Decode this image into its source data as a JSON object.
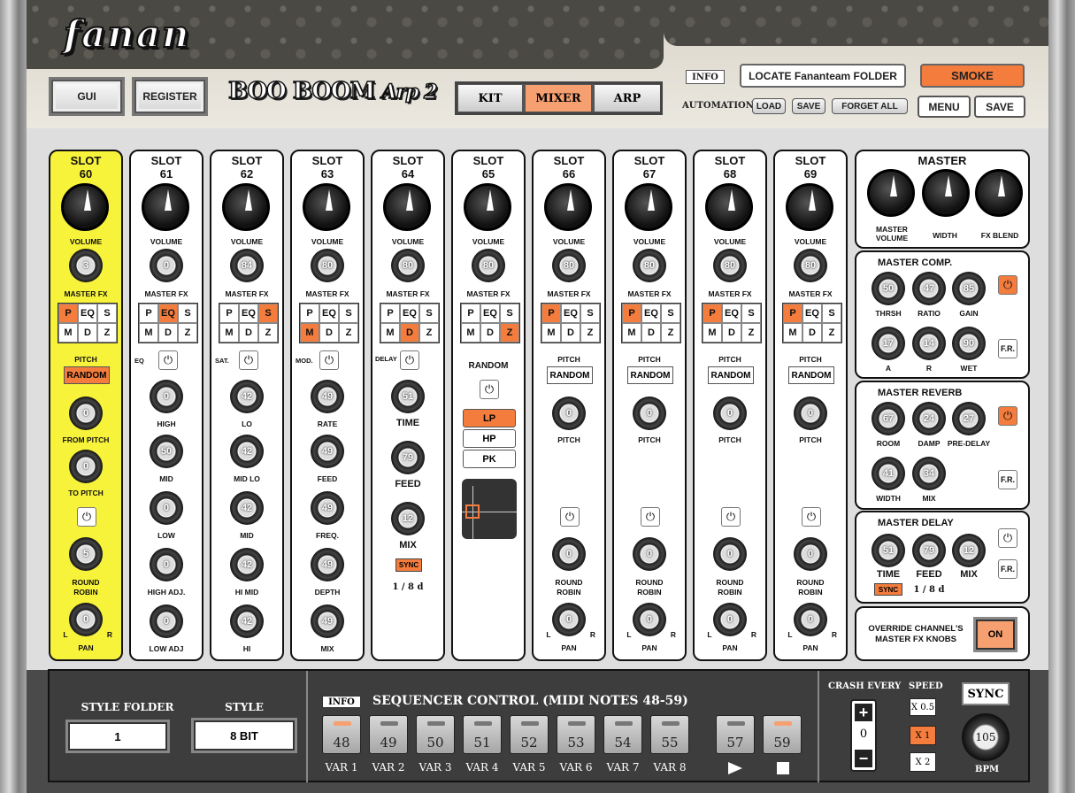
{
  "app": {
    "logo": "fanan",
    "title": "BOO BOOM",
    "title_suffix": "Arp 2"
  },
  "top": {
    "gui": "GUI",
    "register": "REGISTER",
    "tabs": [
      "KIT",
      "MIXER",
      "ARP"
    ],
    "active_tab": "MIXER",
    "info": "INFO",
    "locate": "LOCATE Fananteam FOLDER",
    "smoke": "SMOKE",
    "automation": "AUTOMATION",
    "load": "LOAD",
    "save_small": "SAVE",
    "forget_all": "FORGET ALL",
    "menu": "MENU",
    "save": "SAVE"
  },
  "labels": {
    "slot": "SLOT",
    "volume": "VOLUME",
    "master_fx": "MASTER FX",
    "pitch_head": "PITCH",
    "random": "RANDOM",
    "pitch": "PITCH",
    "from_pitch": "FROM PITCH",
    "to_pitch": "TO PITCH",
    "round": "ROUND",
    "robin": "ROBIN",
    "pan": "PAN",
    "l": "L",
    "r": "R",
    "p": "P",
    "eq": "EQ",
    "s": "S",
    "m": "M",
    "d": "D",
    "z": "Z"
  },
  "slots": [
    {
      "num": "60",
      "fx": "3"
    },
    {
      "num": "61",
      "fx": "0"
    },
    {
      "num": "62",
      "fx": "84"
    },
    {
      "num": "63",
      "fx": "80"
    },
    {
      "num": "64",
      "fx": "80"
    },
    {
      "num": "65",
      "fx": "80"
    },
    {
      "num": "66",
      "fx": "80"
    },
    {
      "num": "67",
      "fx": "80"
    },
    {
      "num": "68",
      "fx": "80"
    },
    {
      "num": "69",
      "fx": "80"
    }
  ],
  "slot60": {
    "from_pitch": "0",
    "to_pitch": "0",
    "round_robin": "5",
    "pan": "0"
  },
  "slot61": {
    "section": "EQ",
    "knobs": [
      {
        "v": "0",
        "l": "HIGH"
      },
      {
        "v": "50",
        "l": "MID"
      },
      {
        "v": "0",
        "l": "LOW"
      },
      {
        "v": "0",
        "l": "HIGH ADJ."
      },
      {
        "v": "0",
        "l": "LOW ADJ"
      }
    ]
  },
  "slot62": {
    "section": "SAT.",
    "knobs": [
      {
        "v": "42",
        "l": "LO"
      },
      {
        "v": "42",
        "l": "MID LO"
      },
      {
        "v": "42",
        "l": "MID"
      },
      {
        "v": "42",
        "l": "HI MID"
      },
      {
        "v": "42",
        "l": "HI"
      }
    ]
  },
  "slot63": {
    "section": "MOD.",
    "knobs": [
      {
        "v": "49",
        "l": "RATE"
      },
      {
        "v": "49",
        "l": "FEED"
      },
      {
        "v": "49",
        "l": "FREQ."
      },
      {
        "v": "49",
        "l": "DEPTH"
      },
      {
        "v": "49",
        "l": "MIX"
      }
    ]
  },
  "slot64": {
    "section": "DELAY",
    "knobs": [
      {
        "v": "51",
        "l": "TIME"
      },
      {
        "v": "79",
        "l": "FEED"
      },
      {
        "v": "12",
        "l": "MIX"
      }
    ],
    "sync": "SYNC",
    "division": "1 / 8 d"
  },
  "slot65": {
    "random": "RANDOM",
    "filters": [
      "LP",
      "HP",
      "PK"
    ]
  },
  "std": {
    "pitch": "0",
    "round_robin": "0",
    "pan": "0"
  },
  "master": {
    "title": "MASTER",
    "volume": "MASTER VOLUME",
    "width": "WIDTH",
    "fx_blend": "FX BLEND",
    "comp": {
      "title": "MASTER COMP.",
      "knobs": [
        {
          "v": "50",
          "l": "THRSH"
        },
        {
          "v": "47",
          "l": "RATIO"
        },
        {
          "v": "85",
          "l": "GAIN"
        },
        {
          "v": "17",
          "l": "A"
        },
        {
          "v": "14",
          "l": "R"
        },
        {
          "v": "90",
          "l": "WET"
        }
      ],
      "fr": "F.R."
    },
    "reverb": {
      "title": "MASTER REVERB",
      "knobs": [
        {
          "v": "67",
          "l": "ROOM"
        },
        {
          "v": "24",
          "l": "DAMP"
        },
        {
          "v": "27",
          "l": "PRE-DELAY"
        },
        {
          "v": "41",
          "l": "WIDTH"
        },
        {
          "v": "34",
          "l": "MIX"
        }
      ],
      "fr": "F.R."
    },
    "delay": {
      "title": "MASTER DELAY",
      "knobs": [
        {
          "v": "51",
          "l": "TIME"
        },
        {
          "v": "79",
          "l": "FEED"
        },
        {
          "v": "12",
          "l": "MIX"
        }
      ],
      "sync": "SYNC",
      "division": "1 / 8 d",
      "fr": "F.R."
    },
    "override": "OVERRIDE CHANNEL'S MASTER FX KNOBS",
    "override_btn": "ON"
  },
  "bottom": {
    "style_folder": "STYLE FOLDER",
    "style_folder_val": "1",
    "style": "STYLE",
    "style_val": "8 BIT",
    "info": "INFO",
    "seq_title": "SEQUENCER CONTROL (MIDI NOTES 48-59)",
    "pads": [
      {
        "n": "48",
        "v": "VAR 1",
        "on": true
      },
      {
        "n": "49",
        "v": "VAR 2"
      },
      {
        "n": "50",
        "v": "VAR 3"
      },
      {
        "n": "51",
        "v": "VAR 4"
      },
      {
        "n": "52",
        "v": "VAR 5"
      },
      {
        "n": "53",
        "v": "VAR 6"
      },
      {
        "n": "54",
        "v": "VAR 7"
      },
      {
        "n": "55",
        "v": "VAR 8"
      }
    ],
    "play": {
      "n": "57"
    },
    "stop": {
      "n": "59"
    },
    "crash": "CRASH EVERY",
    "crash_val": "0",
    "speed": "SPEED",
    "speeds": [
      "X 0.5",
      "X 1",
      "X 2"
    ],
    "sync": "SYNC",
    "bpm_val": "105",
    "bpm": "BPM"
  }
}
